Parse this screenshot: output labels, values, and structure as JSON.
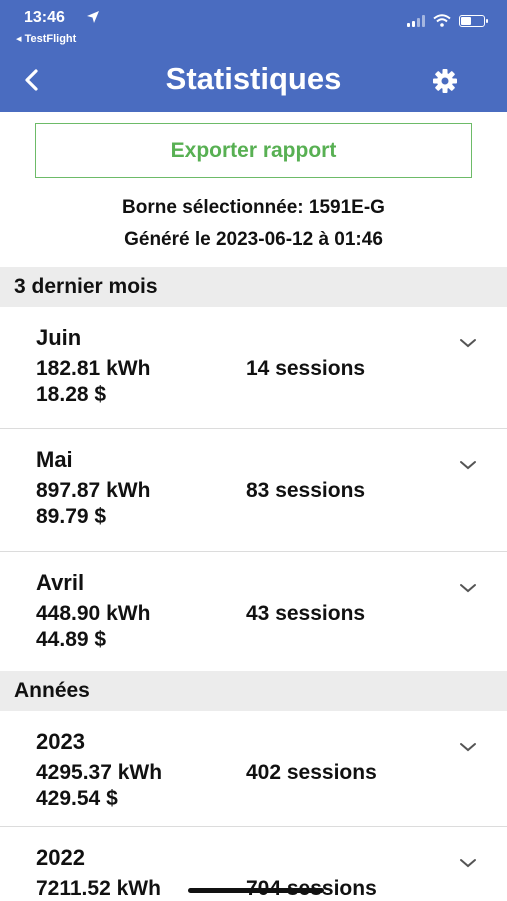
{
  "status_bar": {
    "time": "13:46",
    "back_app": "◂ TestFlight",
    "icons": [
      "location-arrow-icon",
      "signal-icon",
      "wifi-icon",
      "battery-icon"
    ]
  },
  "nav": {
    "title": "Statistiques",
    "back_icon": "chevron-left-icon",
    "settings_icon": "gear-icon"
  },
  "export_button": {
    "label": "Exporter rapport",
    "color": "#58b053"
  },
  "info": {
    "station": "Borne sélectionnée: 1591E-G",
    "generated": "Généré le 2023-06-12 à 01:46"
  },
  "sections": [
    {
      "title": "3 dernier mois",
      "rows": [
        {
          "title": "Juin",
          "kwh": "182.81 kWh",
          "cost": "18.28 $",
          "sessions": "14 sessions"
        },
        {
          "title": "Mai",
          "kwh": "897.87 kWh",
          "cost": "89.79 $",
          "sessions": "83 sessions"
        },
        {
          "title": "Avril",
          "kwh": "448.90 kWh",
          "cost": "44.89 $",
          "sessions": "43 sessions"
        }
      ]
    },
    {
      "title": "Années",
      "rows": [
        {
          "title": "2023",
          "kwh": "4295.37 kWh",
          "cost": "429.54 $",
          "sessions": "402 sessions"
        },
        {
          "title": "2022",
          "kwh": "7211.52 kWh",
          "cost": "",
          "sessions": "704 sessions"
        }
      ]
    }
  ],
  "colors": {
    "header": "#4a6cc0",
    "accent_green": "#58b053",
    "section_bg": "#ececec"
  }
}
